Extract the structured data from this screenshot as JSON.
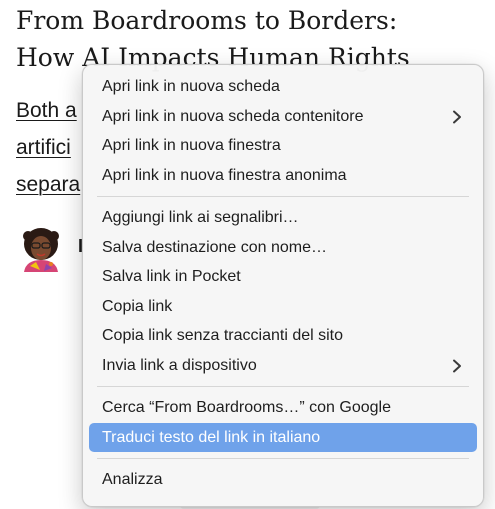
{
  "article": {
    "headline": "From Boardrooms to Borders:\nHow AI Impacts Human Rights",
    "intro_lines": [
      "Both a",
      "artifici",
      "separa"
    ],
    "author_initial": "I"
  },
  "context_menu": {
    "accent_color": "#6fa2ea",
    "groups": [
      {
        "items": [
          {
            "label": "Apri link in nuova scheda"
          },
          {
            "label": "Apri link in nuova scheda contenitore",
            "submenu_icon": "chevron-right-icon"
          },
          {
            "label": "Apri link in nuova finestra"
          },
          {
            "label": "Apri link in nuova finestra anonima"
          }
        ]
      },
      {
        "items": [
          {
            "label": "Aggiungi link ai segnalibri…"
          },
          {
            "label": "Salva destinazione con nome…"
          },
          {
            "label": "Salva link in Pocket"
          },
          {
            "label": "Copia link"
          },
          {
            "label": "Copia link senza traccianti del sito"
          },
          {
            "label": "Invia link a dispositivo",
            "submenu_icon": "chevron-right-icon"
          }
        ]
      },
      {
        "items": [
          {
            "label": "Cerca “From Boardrooms…” con Google"
          },
          {
            "label": "Traduci testo del link in italiano",
            "highlighted": true
          }
        ]
      },
      {
        "items": [
          {
            "label": "Analizza"
          }
        ]
      }
    ]
  }
}
